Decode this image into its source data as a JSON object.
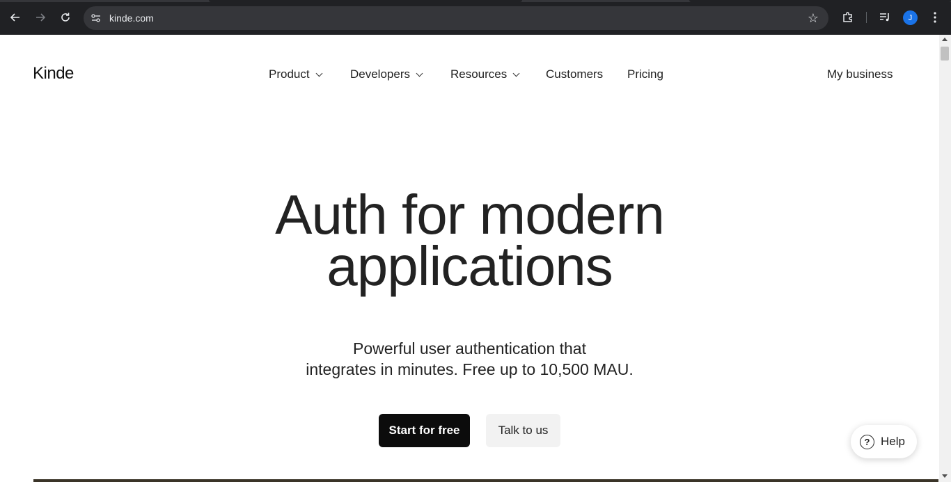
{
  "browser": {
    "url": "kinde.com",
    "back_icon": "arrow-left-icon",
    "forward_icon": "arrow-right-icon",
    "reload_icon": "reload-icon",
    "avatar_initial": "J"
  },
  "site": {
    "logo": "Kinde",
    "nav": {
      "items": [
        {
          "label": "Product",
          "has_dropdown": true
        },
        {
          "label": "Developers",
          "has_dropdown": true
        },
        {
          "label": "Resources",
          "has_dropdown": true
        },
        {
          "label": "Customers",
          "has_dropdown": false
        },
        {
          "label": "Pricing",
          "has_dropdown": false
        }
      ],
      "account_link": "My business"
    },
    "hero": {
      "title_line1": "Auth for modern",
      "title_line2": "applications",
      "subtitle_line1": "Powerful user authentication that",
      "subtitle_line2": "integrates in minutes. Free up to 10,500 MAU.",
      "primary_cta": "Start for free",
      "secondary_cta": "Talk to us"
    },
    "help_widget": {
      "label": "Help",
      "icon_text": "?"
    }
  },
  "colors": {
    "chrome_bg": "#202124",
    "omnibox_bg": "#35363a",
    "primary_button_bg": "#0c0c0c",
    "secondary_button_bg": "#f2f2f2",
    "avatar_bg": "#1a73e8"
  }
}
